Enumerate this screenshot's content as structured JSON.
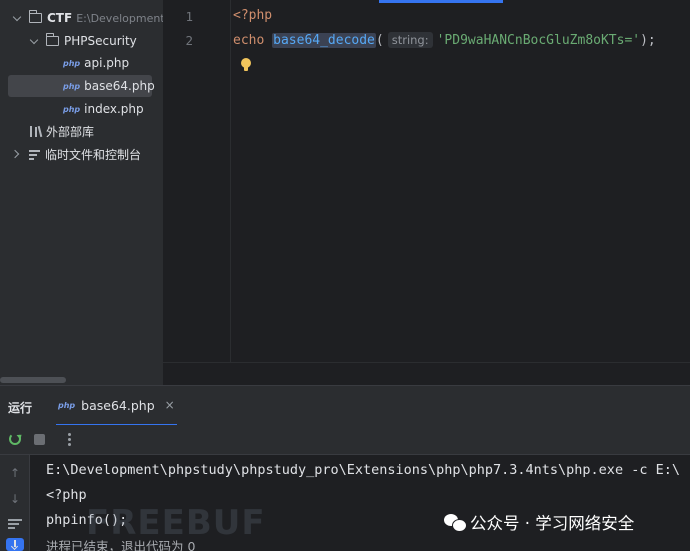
{
  "project_tree": {
    "root": {
      "label": "CTF",
      "path_hint": "E:\\Development\\"
    },
    "folder": {
      "label": "PHPSecurity"
    },
    "files": [
      {
        "icon": "php",
        "label": "api.php"
      },
      {
        "icon": "php",
        "label": "base64.php",
        "selected": true
      },
      {
        "icon": "php",
        "label": "index.php"
      }
    ],
    "external_libraries": "外部部库",
    "scratches": "临时文件和控制台"
  },
  "editor": {
    "line_numbers": [
      "1",
      "2"
    ],
    "line1": {
      "open_tag": "<?php"
    },
    "line2": {
      "keyword": "echo",
      "function": "base64_decode",
      "open_paren": "(",
      "param_hint": "string:",
      "string_literal": "'PD9waHANCnBocGluZm8oKTs='",
      "close": ");"
    }
  },
  "run_panel": {
    "title": "运行",
    "tab": {
      "icon": "php",
      "label": "base64.php",
      "close": "×"
    },
    "console_lines": [
      "E:\\Development\\phpstudy\\phpstudy_pro\\Extensions\\php\\php7.3.4nts\\php.exe -c E:\\",
      "<?php",
      "phpinfo();",
      "进程已结束，退出代码为 0"
    ]
  },
  "watermarks": {
    "freebuf": "FREEBUF",
    "wechat": "公众号 · 学习网络安全"
  },
  "colors": {
    "accent": "#3574f0",
    "php_tag": "#cf8e6d",
    "function": "#56a8f5",
    "string": "#6aab73",
    "panel_bg": "#2b2d30",
    "editor_bg": "#1e1f22"
  }
}
